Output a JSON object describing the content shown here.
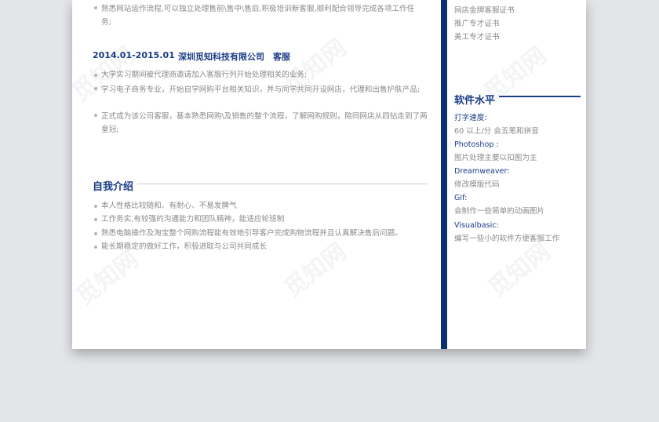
{
  "left": {
    "top_item": "熟悉网站运作流程,可以独立处理售前\\售中\\售后,积极培训新客服,顺利配合领导完成各项工作任务;",
    "job": {
      "period": "2014.01-2015.01",
      "company": "深圳觅知科技有限公司",
      "role": "客服",
      "items": [
        "大学实习期间被代理商邀请加入客服行列开始处理相关的业务;",
        "学习电子商务专业，开始自学网购平台相关知识，并与同学共同开设网店，代理和出售护肤产品;",
        "正式成为该公司客服，基本熟悉网购\\及销售的整个流程，了解网购规则，陪同网店从四钻走到了两皇冠;"
      ]
    },
    "intro": {
      "title": "自我介绍",
      "items": [
        "本人性格比较随和、有耐心、不易发脾气",
        "工作务实,有较强的沟通能力和团队精神，能适应轮班制",
        "熟悉电脑操作及淘宝整个网购流程能有效地引导客户完成购物流程并且认真解决售后问题。",
        "能长期稳定的做好工作，积极进取与公司共同成长"
      ]
    }
  },
  "right": {
    "certs": [
      "网店金牌客服证书",
      "推广专才证书",
      "美工专才证书"
    ],
    "software": {
      "title": "软件水平",
      "entries": [
        {
          "label": "打字速度:",
          "desc": "60 以上/分  会五笔和拼音"
        },
        {
          "label": "Photoshop :",
          "desc": "图片处理主要以扣图为主"
        },
        {
          "label": "Dreamweaver:",
          "desc": "修改模版代码"
        },
        {
          "label": "Gif:",
          "desc": "会制作一些简单的动画图片"
        },
        {
          "label": "Visualbasic:",
          "desc": "编写一些小的软件方便客服工作"
        }
      ]
    }
  },
  "watermark": "觅知网",
  "colors": {
    "accent": "#1a3c86",
    "divider": "#0d2f73",
    "text": "#8a8a8a",
    "background": "#e3e5e8"
  }
}
